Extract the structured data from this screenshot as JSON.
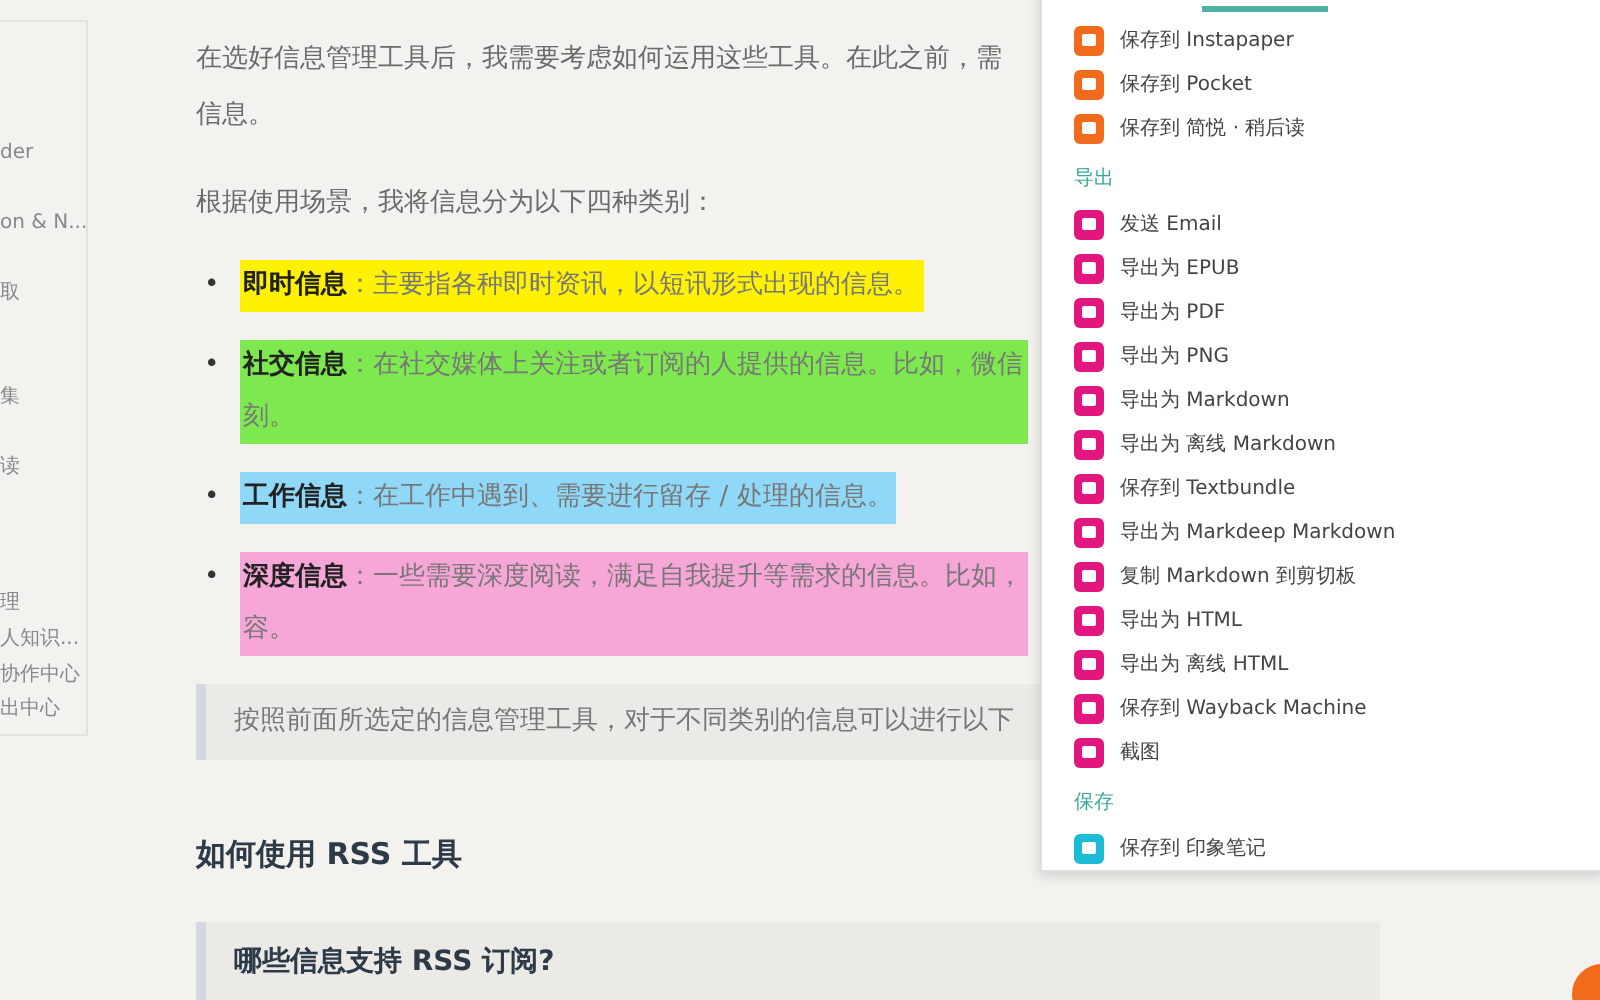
{
  "sidebar": {
    "items": [
      "der",
      "on & N...",
      "取",
      "集",
      "读",
      "理",
      "人知识...",
      "协作中心",
      "出中心"
    ]
  },
  "article": {
    "intro": [
      "在选好信息管理工具后，我需要考虑如何运用这些工具。在此之前，需",
      "信息。"
    ],
    "lead": "根据使用场景，我将信息分为以下四种类别：",
    "categories": [
      {
        "marker": "•",
        "lines": [
          "**即时信息**：主要指各种即时资讯，以短讯形式出现的信息。"
        ],
        "color": "#fff200"
      },
      {
        "marker": "•",
        "lines": [
          "**社交信息**：在社交媒体上关注或者订阅的人提供的信息。比如，微信",
          "刻。"
        ],
        "color": "#7ee84f"
      },
      {
        "marker": "•",
        "lines": [
          "**工作信息**：在工作中遇到、需要进行留存 / 处理的信息。"
        ],
        "color": "#8fd8f8"
      },
      {
        "marker": "•",
        "lines": [
          "**深度信息**：一些需要深度阅读，满足自我提升等需求的信息。比如，",
          "容。"
        ],
        "color": "#f7a6d8"
      }
    ],
    "quote": "按照前面所选定的信息管理工具，对于不同类别的信息可以进行以下",
    "heading": "如何使用 RSS 工具",
    "question": "哪些信息支持 RSS 订阅?"
  },
  "menu": {
    "groups": [
      {
        "items": [
          {
            "label": "保存到 Instapaper",
            "color": "#f26a1b"
          },
          {
            "label": "保存到 Pocket",
            "color": "#f26a1b"
          },
          {
            "label": "保存到 简悦 · 稍后读",
            "color": "#f26a1b"
          }
        ]
      },
      {
        "title": "导出",
        "items": [
          {
            "label": "发送 Email",
            "color": "#e3157f"
          },
          {
            "label": "导出为 EPUB",
            "color": "#e3157f"
          },
          {
            "label": "导出为 PDF",
            "color": "#e3157f"
          },
          {
            "label": "导出为 PNG",
            "color": "#e3157f"
          },
          {
            "label": "导出为 Markdown",
            "color": "#e3157f"
          },
          {
            "label": "导出为 离线 Markdown",
            "color": "#e3157f"
          },
          {
            "label": "保存到 Textbundle",
            "color": "#e3157f"
          },
          {
            "label": "导出为 Markdeep Markdown",
            "color": "#e3157f"
          },
          {
            "label": "复制 Markdown 到剪切板",
            "color": "#e3157f"
          },
          {
            "label": "导出为 HTML",
            "color": "#e3157f"
          },
          {
            "label": "导出为 离线 HTML",
            "color": "#e3157f"
          },
          {
            "label": "保存到 Wayback Machine",
            "color": "#e3157f"
          },
          {
            "label": "截图",
            "color": "#e3157f"
          }
        ]
      },
      {
        "title": "保存",
        "items": [
          {
            "label": "保存到 印象笔记",
            "color": "#1cbcd4"
          }
        ]
      }
    ]
  }
}
